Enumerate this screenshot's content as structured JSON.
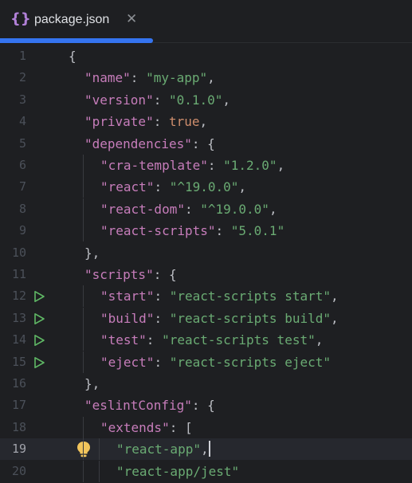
{
  "tab": {
    "icon": "{}",
    "title": "package.json",
    "close": "✕"
  },
  "editor": {
    "current_line": 19,
    "lines": [
      {
        "num": "1",
        "tokens": [
          [
            "p",
            "{"
          ]
        ]
      },
      {
        "num": "2",
        "tokens": [
          [
            "k",
            "\"name\""
          ],
          [
            "p",
            ": "
          ],
          [
            "s",
            "\"my-app\""
          ],
          [
            "p",
            ","
          ]
        ]
      },
      {
        "num": "3",
        "tokens": [
          [
            "k",
            "\"version\""
          ],
          [
            "p",
            ": "
          ],
          [
            "s",
            "\"0.1.0\""
          ],
          [
            "p",
            ","
          ]
        ]
      },
      {
        "num": "4",
        "tokens": [
          [
            "k",
            "\"private\""
          ],
          [
            "p",
            ": "
          ],
          [
            "kw",
            "true"
          ],
          [
            "p",
            ","
          ]
        ]
      },
      {
        "num": "5",
        "tokens": [
          [
            "k",
            "\"dependencies\""
          ],
          [
            "p",
            ": {"
          ]
        ]
      },
      {
        "num": "6",
        "tokens": [
          [
            "k",
            "\"cra-template\""
          ],
          [
            "p",
            ": "
          ],
          [
            "s",
            "\"1.2.0\""
          ],
          [
            "p",
            ","
          ]
        ]
      },
      {
        "num": "7",
        "tokens": [
          [
            "k",
            "\"react\""
          ],
          [
            "p",
            ": "
          ],
          [
            "s",
            "\"^19.0.0\""
          ],
          [
            "p",
            ","
          ]
        ]
      },
      {
        "num": "8",
        "tokens": [
          [
            "k",
            "\"react-dom\""
          ],
          [
            "p",
            ": "
          ],
          [
            "s",
            "\"^19.0.0\""
          ],
          [
            "p",
            ","
          ]
        ]
      },
      {
        "num": "9",
        "tokens": [
          [
            "k",
            "\"react-scripts\""
          ],
          [
            "p",
            ": "
          ],
          [
            "s",
            "\"5.0.1\""
          ]
        ]
      },
      {
        "num": "10",
        "tokens": [
          [
            "p",
            "},"
          ]
        ]
      },
      {
        "num": "11",
        "tokens": [
          [
            "k",
            "\"scripts\""
          ],
          [
            "p",
            ": {"
          ]
        ]
      },
      {
        "num": "12",
        "run": true,
        "tokens": [
          [
            "k",
            "\"start\""
          ],
          [
            "p",
            ": "
          ],
          [
            "s",
            "\"react-scripts start\""
          ],
          [
            "p",
            ","
          ]
        ]
      },
      {
        "num": "13",
        "run": true,
        "tokens": [
          [
            "k",
            "\"build\""
          ],
          [
            "p",
            ": "
          ],
          [
            "s",
            "\"react-scripts build\""
          ],
          [
            "p",
            ","
          ]
        ]
      },
      {
        "num": "14",
        "run": true,
        "tokens": [
          [
            "k",
            "\"test\""
          ],
          [
            "p",
            ": "
          ],
          [
            "s",
            "\"react-scripts test\""
          ],
          [
            "p",
            ","
          ]
        ]
      },
      {
        "num": "15",
        "run": true,
        "tokens": [
          [
            "k",
            "\"eject\""
          ],
          [
            "p",
            ": "
          ],
          [
            "s",
            "\"react-scripts eject\""
          ]
        ]
      },
      {
        "num": "16",
        "tokens": [
          [
            "p",
            "},"
          ]
        ]
      },
      {
        "num": "17",
        "tokens": [
          [
            "k",
            "\"eslintConfig\""
          ],
          [
            "p",
            ": {"
          ]
        ]
      },
      {
        "num": "18",
        "tokens": [
          [
            "k",
            "\"extends\""
          ],
          [
            "p",
            ": ["
          ]
        ]
      },
      {
        "num": "19",
        "bulb": true,
        "caret": true,
        "tokens": [
          [
            "s",
            "\"react-app\""
          ],
          [
            "p",
            ","
          ]
        ]
      },
      {
        "num": "20",
        "tokens": [
          [
            "s",
            "\"react-app/jest\""
          ]
        ]
      }
    ]
  },
  "colors": {
    "background": "#1e1f22",
    "key": "#c77dbb",
    "string": "#6aab73",
    "keyword": "#cf8e6d",
    "accent": "#3574f0",
    "run_icon": "#5fb865"
  },
  "icons": {
    "tab_icon": "json-braces-icon",
    "close": "close-icon",
    "run": "run-gutter-icon",
    "intention": "lightbulb-icon"
  }
}
